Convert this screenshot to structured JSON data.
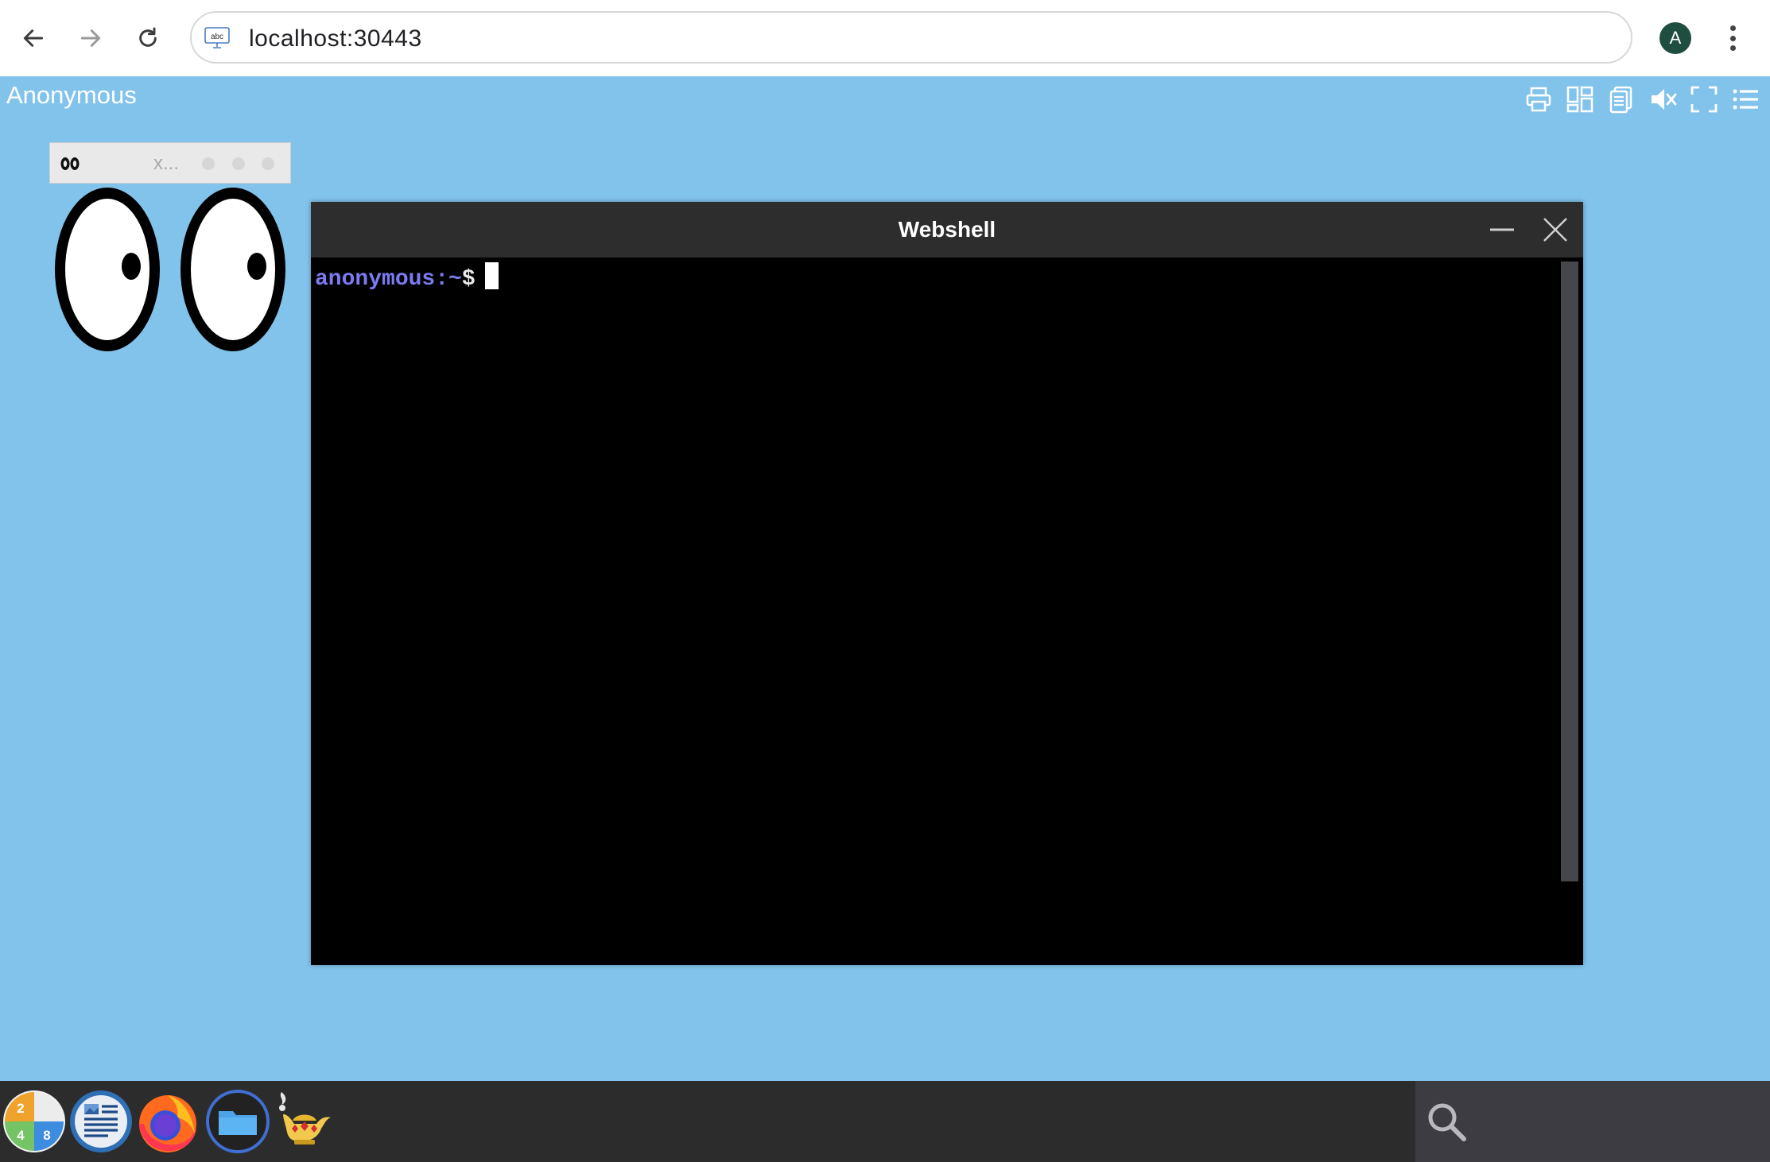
{
  "browser": {
    "url": "localhost:30443",
    "site_icon_label": "abc",
    "profile_initial": "A"
  },
  "desktop": {
    "session_user": "Anonymous",
    "toolbar_icons": [
      "printer-icon",
      "layout-grid-icon",
      "clipboard-icon",
      "mute-icon",
      "fullscreen-icon",
      "menu-list-icon"
    ],
    "background_color": "#82c3ec"
  },
  "xeyes_window": {
    "title": "x..."
  },
  "webshell_window": {
    "title": "Webshell",
    "prompt_user": "anonymous",
    "prompt_path": ":~",
    "prompt_symbol": "$"
  },
  "taskbar": {
    "launchers": [
      "calculator-icon",
      "document-viewer-icon",
      "firefox-icon",
      "file-manager-icon",
      "genie-lamp-icon"
    ],
    "calculator_digits": [
      "2",
      "4",
      "8"
    ]
  }
}
